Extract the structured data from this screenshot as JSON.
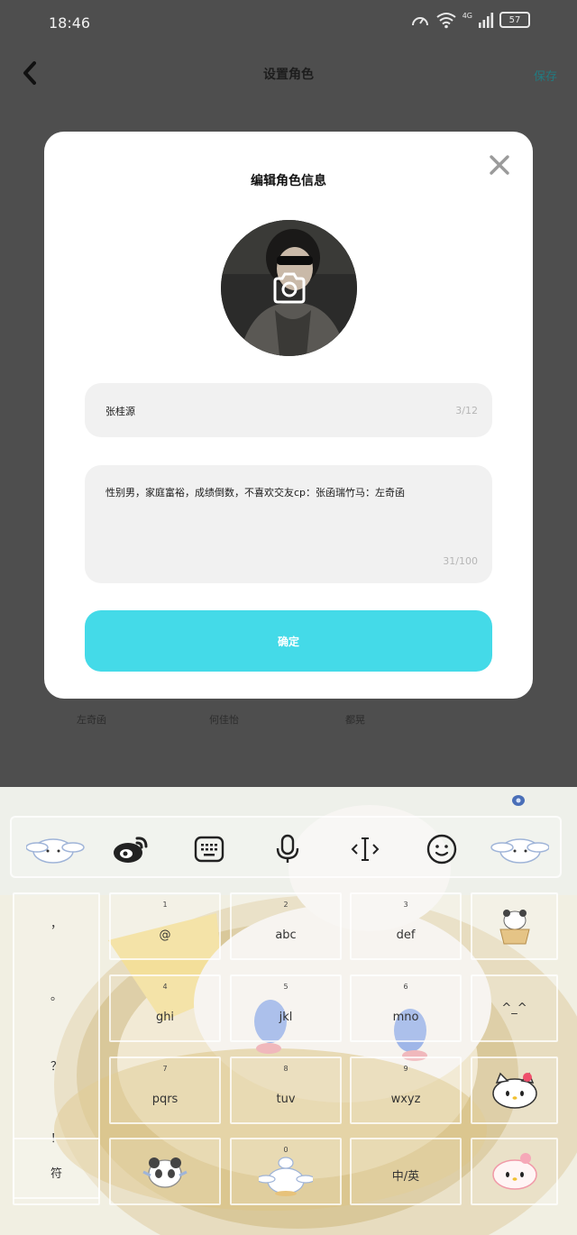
{
  "status_bar": {
    "time": "18:46",
    "network": "4G",
    "battery": "57"
  },
  "header": {
    "title": "设置角色",
    "save_label": "保存"
  },
  "background_names": [
    "左奇函",
    "何佳怡",
    "都晃"
  ],
  "modal": {
    "title": "编辑角色信息",
    "name_value": "张桂源",
    "name_counter": "3/12",
    "description_value": "性别男，家庭富裕，成绩倒数，不喜欢交友cp：张函瑞竹马：左奇函",
    "description_counter": "31/100",
    "confirm_label": "确定"
  },
  "keyboard": {
    "symbols": [
      "，",
      "。",
      "？",
      "！"
    ],
    "symbol_key": "符",
    "keys": [
      {
        "num": "1",
        "label": "@"
      },
      {
        "num": "2",
        "label": "abc"
      },
      {
        "num": "3",
        "label": "def"
      },
      {
        "num": "4",
        "label": "ghi"
      },
      {
        "num": "5",
        "label": "jkl"
      },
      {
        "num": "6",
        "label": "mno"
      },
      {
        "num": "7",
        "label": "pqrs"
      },
      {
        "num": "8",
        "label": "tuv"
      },
      {
        "num": "9",
        "label": "wxyz"
      }
    ],
    "emoticon": "^_^",
    "zero_num": "0",
    "lang_key": "中/英"
  },
  "colors": {
    "accent": "#44dae8",
    "overlay": "#4e4e4e",
    "save_text": "#227a80"
  },
  "icons": [
    "sticker-icon",
    "weibo-icon",
    "keyboard-icon",
    "microphone-icon",
    "text-cursor-icon",
    "emoji-icon",
    "camera-icon",
    "close-icon",
    "back-arrow-icon"
  ]
}
